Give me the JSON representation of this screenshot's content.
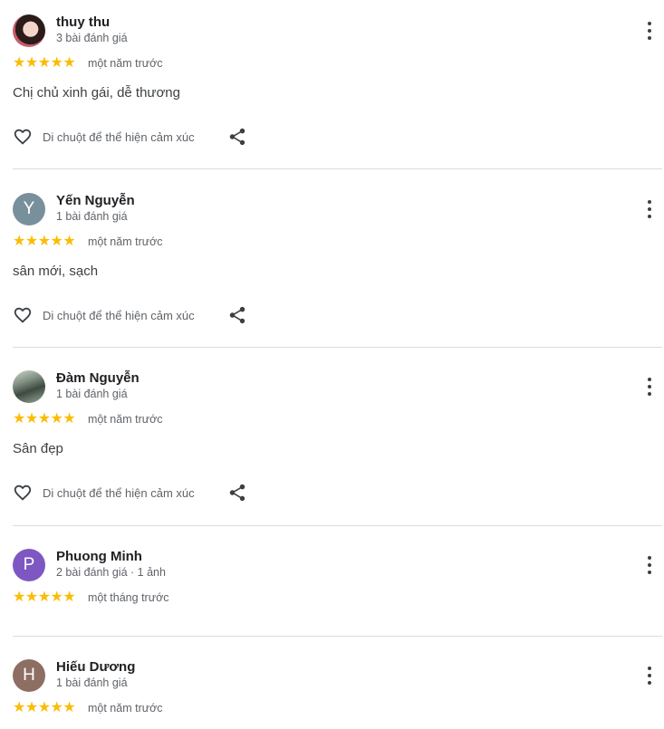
{
  "reviews": [
    {
      "author": "thuy thu",
      "meta": "3 bài đánh giá",
      "avatar_letter": "",
      "avatar_color": "#c75b6a",
      "rating": 5,
      "time": "một năm trước",
      "text": "Chị chủ xinh gái, dễ thương",
      "reaction_label": "Di chuột để thể hiện cảm xúc"
    },
    {
      "author": "Yến Nguyễn",
      "meta": "1 bài đánh giá",
      "avatar_letter": "Y",
      "avatar_color": "#78909c",
      "rating": 5,
      "time": "một năm trước",
      "text": "sân mới, sạch",
      "reaction_label": "Di chuột để thể hiện cảm xúc"
    },
    {
      "author": "Đàm Nguyễn",
      "meta": "1 bài đánh giá",
      "avatar_letter": "",
      "avatar_color": "#5d6d62",
      "rating": 5,
      "time": "một năm trước",
      "text": "Sân đẹp",
      "reaction_label": "Di chuột để thể hiện cảm xúc"
    },
    {
      "author": "Phuong Minh",
      "meta": "2 bài đánh giá · 1 ảnh",
      "avatar_letter": "P",
      "avatar_color": "#7e57c2",
      "rating": 5,
      "time": "một tháng trước"
    },
    {
      "author": "Hiếu Dương",
      "meta": "1 bài đánh giá",
      "avatar_letter": "H",
      "avatar_color": "#8d6e63",
      "rating": 5,
      "time": "một năm trước"
    }
  ],
  "colors": {
    "star": "#fbbc04",
    "divider": "#dadce0",
    "icon": "#3c4043"
  },
  "icons": {
    "more": "more-vert-icon",
    "heart": "heart-outline-icon",
    "share": "share-icon",
    "star": "star-icon"
  }
}
